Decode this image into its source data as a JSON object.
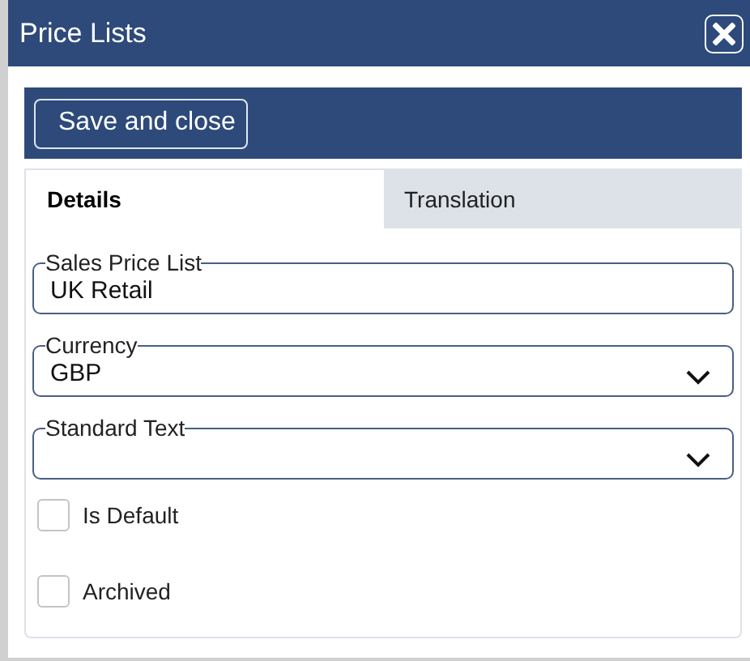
{
  "window": {
    "title": "Price Lists"
  },
  "toolbar": {
    "buttons": [
      "Save and close"
    ]
  },
  "tabs": [
    {
      "label": "Details",
      "selected": true
    },
    {
      "label": "Translation",
      "selected": false
    }
  ],
  "fields": [
    {
      "kind": "text",
      "label": "Sales Price List",
      "value": "UK Retail"
    },
    {
      "kind": "select",
      "label": "Currency",
      "value": "GBP"
    },
    {
      "kind": "select",
      "label": "Standard Text"
    }
  ],
  "checkboxes": [
    {
      "label": "Is Default",
      "checked": false
    },
    {
      "label": "Archived",
      "checked": false
    }
  ]
}
